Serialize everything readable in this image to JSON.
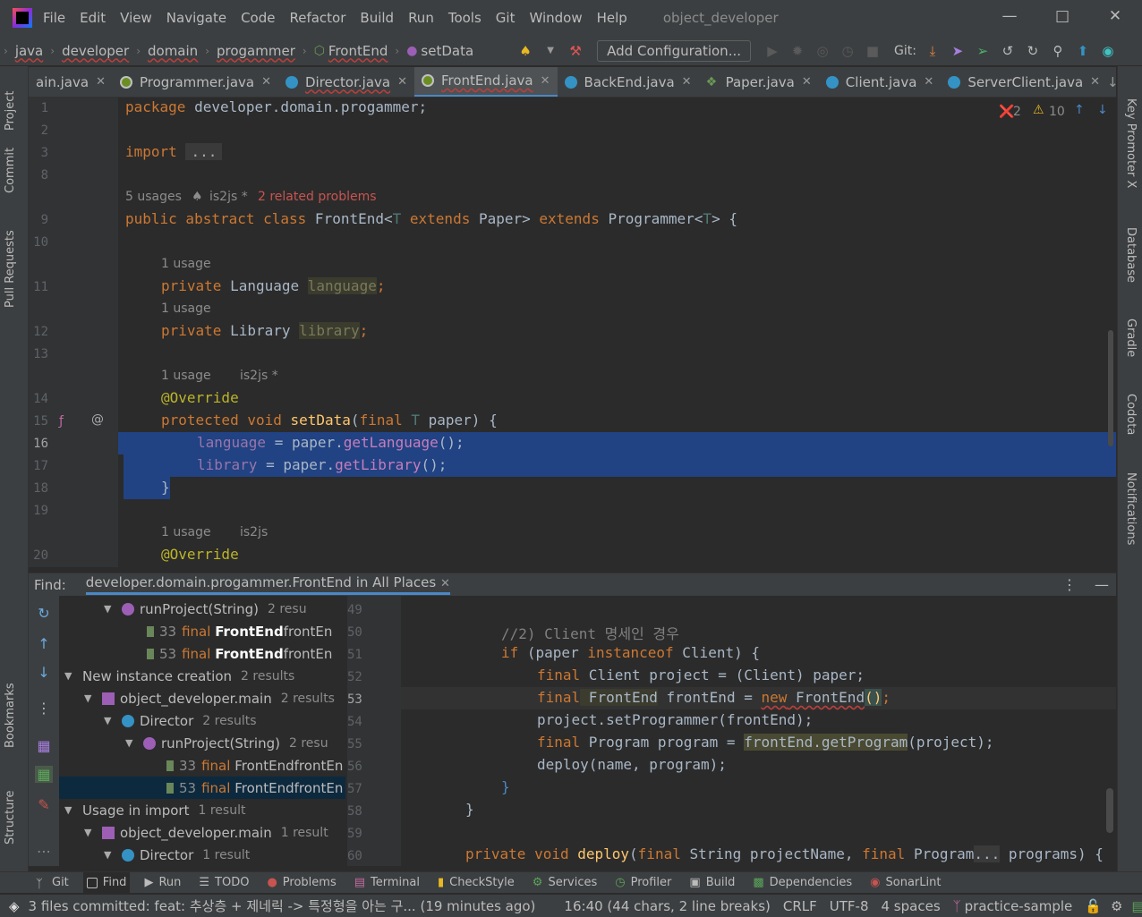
{
  "menubar": {
    "items": [
      "File",
      "Edit",
      "View",
      "Navigate",
      "Code",
      "Refactor",
      "Build",
      "Run",
      "Tools",
      "Git",
      "Window",
      "Help"
    ],
    "project_title": "object_developer"
  },
  "navbar": {
    "crumbs": [
      "java",
      "developer",
      "domain",
      "progammer",
      "FrontEnd",
      "setData"
    ],
    "add_configuration": "Add Configuration...",
    "git_label": "Git:"
  },
  "tabs": [
    {
      "label": "ain.java"
    },
    {
      "label": "Programmer.java"
    },
    {
      "label": "Director.java"
    },
    {
      "label": "FrontEnd.java"
    },
    {
      "label": "BackEnd.java"
    },
    {
      "label": "Paper.java"
    },
    {
      "label": "Client.java"
    },
    {
      "label": "ServerClient.java"
    }
  ],
  "left_strip": [
    "Project",
    "Commit",
    "Pull Requests",
    "Bookmarks",
    "Structure"
  ],
  "right_strip": [
    "Key Promoter X",
    "Database",
    "Gradle",
    "Codota",
    "Notifications"
  ],
  "editor": {
    "error_count": "2",
    "warning_count": "10",
    "line_numbers": [
      "1",
      "2",
      "3",
      "8",
      "9",
      "10",
      "11",
      "12",
      "13",
      "14",
      "15",
      "16",
      "17",
      "18",
      "19",
      "20"
    ],
    "hints": {
      "class_usages": "5 usages",
      "class_author": "is2js *",
      "class_problems": "2 related problems",
      "one_usage": "1 usage",
      "author_star": "is2js *",
      "author": "is2js"
    },
    "code": {
      "l1_kw": "package",
      "l1_rest": " developer.domain.progammer;",
      "l3_kw": "import",
      "l3_fold": "...",
      "l9_a": "public abstract class",
      "l9_b": " FrontEnd<",
      "l9_c": "T",
      "l9_d": " extends",
      "l9_e": " Paper> ",
      "l9_f": "extends",
      "l9_g": " Programmer<",
      "l9_h": "T",
      "l9_i": "> {",
      "l11_a": "private",
      "l11_b": " Language ",
      "l11_c": "language",
      "l11_d": ";",
      "l12_a": "private",
      "l12_b": " Library ",
      "l12_c": "library",
      "l12_d": ";",
      "l14": "@Override",
      "l15_a": "protected void",
      "l15_b": " setData",
      "l15_c": "(",
      "l15_d": "final",
      "l15_e": " T",
      "l15_f": " paper) {",
      "l16_a": "language",
      "l16_b": " = paper.",
      "l16_c": "getLanguage",
      "l16_d": "();",
      "l17_a": "library",
      "l17_b": " = paper.",
      "l17_c": "getLibrary",
      "l17_d": "();",
      "l18": "}",
      "l20": "@Override"
    }
  },
  "find": {
    "label": "Find:",
    "tab": "developer.domain.progammer.FrontEnd in All Places",
    "tree": [
      {
        "name": "runProject(String)",
        "count": "2 resu"
      },
      {
        "line": "33",
        "kw": "final",
        "bold": "FrontEnd",
        "rest": " frontEn"
      },
      {
        "line": "53",
        "kw": "final",
        "bold": "FrontEnd",
        "rest": " frontEn"
      },
      {
        "name": "New instance creation",
        "count": "2 results"
      },
      {
        "name": "object_developer.main",
        "count": "2 results"
      },
      {
        "name": "Director",
        "count": "2 results"
      },
      {
        "name": "runProject(String)",
        "count": "2 resu"
      },
      {
        "line": "33",
        "kw": "final",
        "bold": "FrontEnd",
        "rest": " frontEn"
      },
      {
        "line": "53",
        "kw": "final",
        "bold": "FrontEnd",
        "rest": " frontEn"
      },
      {
        "name": "Usage in import",
        "count": "1 result"
      },
      {
        "name": "object_developer.main",
        "count": "1 result"
      },
      {
        "name": "Director",
        "count": "1 result"
      }
    ],
    "preview_lines": [
      "49",
      "50",
      "51",
      "52",
      "53",
      "54",
      "55",
      "56",
      "57",
      "58",
      "59",
      "60"
    ],
    "preview": {
      "p50": "//2) Client 명세인 경우",
      "p51_kw": "if",
      "p51_a": " (paper ",
      "p51_kw2": "instanceof",
      "p51_b": " Client) {",
      "p52_kw": "final",
      "p52_a": " Client project = (Client) paper;",
      "p53_kw": "final",
      "p53_a": " FrontEnd",
      "p53_b": " frontEnd = ",
      "p53_kw2": "new",
      "p53_c": " FrontEnd",
      "p53_d": "()",
      "p53_e": ";",
      "p54": "project.setProgrammer(frontEnd);",
      "p55_kw": "final",
      "p55_a": " Program program = ",
      "p55_b": "frontEnd.getProgram",
      "p55_c": "(project);",
      "p56": "deploy(name, program);",
      "p57": "}",
      "p58": "}",
      "p60_kw": "private void",
      "p60_a": " deploy",
      "p60_b": "(",
      "p60_kw2": "final",
      "p60_c": " String projectName, ",
      "p60_kw3": "final",
      "p60_d": " Program",
      "p60_e": "...",
      "p60_f": " programs) {"
    }
  },
  "bottom_tools": [
    "Git",
    "Find",
    "Run",
    "TODO",
    "Problems",
    "Terminal",
    "CheckStyle",
    "Services",
    "Profiler",
    "Build",
    "Dependencies",
    "SonarLint"
  ],
  "status": {
    "commit_msg": "3 files committed: feat: 추상층 + 제네릭 -> 특정형을 아는 구... (19 minutes ago)",
    "position": "16:40 (44 chars, 2 line breaks)",
    "line_sep": "CRLF",
    "encoding": "UTF-8",
    "indent": "4 spaces",
    "branch": "practice-sample"
  },
  "colors": {
    "accent": "#4a88c7",
    "selection": "#214283",
    "keyword": "#cc7832",
    "error": "#bc3f3c"
  }
}
